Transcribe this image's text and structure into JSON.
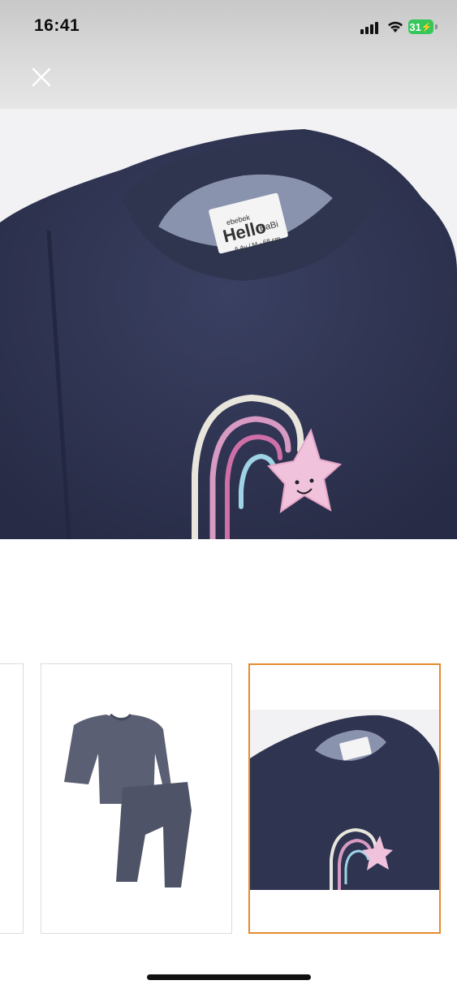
{
  "status_bar": {
    "time": "16:41",
    "battery_level": "31",
    "icons": [
      "signal-icon",
      "wifi-icon",
      "battery-icon"
    ]
  },
  "header": {
    "close_icon": "close-icon"
  },
  "product_image": {
    "label_brand": "ebebek",
    "label_line": "Hello",
    "label_sub": "BaBi",
    "label_size": "6 Ay / M - 68 cm"
  },
  "thumbnails": {
    "selected_index": 2,
    "accent_color": "#e58a2f",
    "items": [
      {
        "name": "thumbnail-partial"
      },
      {
        "name": "thumbnail-full-set"
      },
      {
        "name": "thumbnail-collar-closeup"
      }
    ]
  },
  "colors": {
    "garment": "#2f3450",
    "star": "#f0c2dc"
  }
}
